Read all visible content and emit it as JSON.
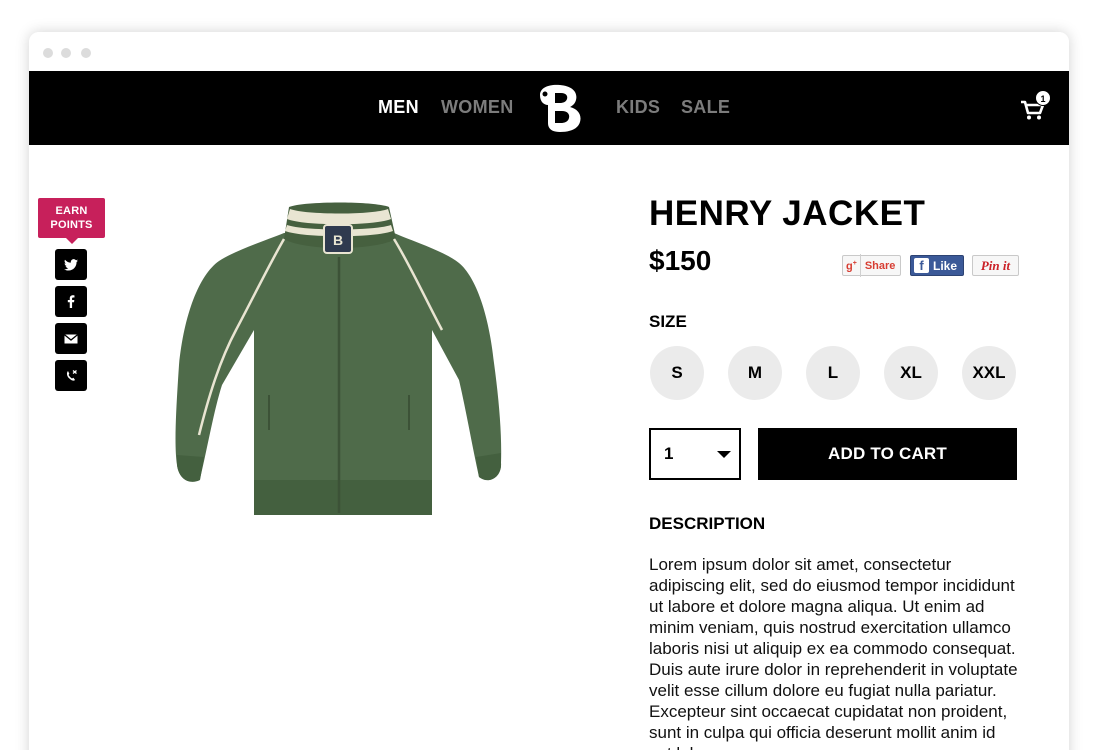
{
  "nav": {
    "links": [
      "MEN",
      "WOMEN",
      "KIDS",
      "SALE"
    ],
    "active": "MEN",
    "cart_count": "1"
  },
  "promo": {
    "earn_points": "EARN POINTS"
  },
  "social": [
    "twitter-icon",
    "facebook-icon",
    "email-icon",
    "phone-icon"
  ],
  "product": {
    "title": "HENRY JACKET",
    "price": "$150",
    "image_color": "#4f6b4a"
  },
  "share": {
    "gplus": "Share",
    "fb": "Like",
    "pin": "Pin it"
  },
  "size": {
    "label": "SIZE",
    "options": [
      "S",
      "M",
      "L",
      "XL",
      "XXL"
    ]
  },
  "purchase": {
    "quantity": "1",
    "add_to_cart": "ADD TO CART"
  },
  "description": {
    "label": "DESCRIPTION",
    "text": "Lorem ipsum dolor sit amet, consectetur adipiscing elit, sed do eiusmod tempor incididunt ut labore et dolore magna aliqua. Ut enim ad minim veniam, quis nostrud exercitation ullamco laboris nisi ut aliquip ex ea commodo consequat. Duis aute irure dolor in reprehenderit in voluptate velit esse cillum dolore eu fugiat nulla pariatur. Excepteur sint occaecat cupidatat non proident, sunt in culpa qui officia deserunt mollit anim id est laborum."
  },
  "colors": {
    "navbar": "#000000",
    "accent": "#c7205b",
    "size_bg": "#ebebeb"
  }
}
